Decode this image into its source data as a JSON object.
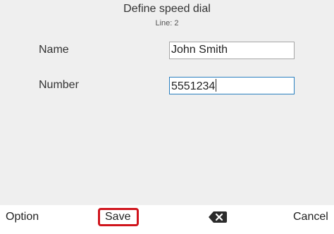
{
  "header": {
    "title": "Define speed dial",
    "subtitle": "Line: 2"
  },
  "form": {
    "name_label": "Name",
    "name_value": "John Smith",
    "number_label": "Number",
    "number_value": "5551234"
  },
  "softkeys": {
    "option_label": "Option",
    "save_label": "Save",
    "backspace_icon": "backspace-icon",
    "cancel_label": "Cancel"
  },
  "colors": {
    "content_background": "#efefef",
    "active_field_border": "#2a7fbf",
    "highlight_red": "#d0141c"
  }
}
